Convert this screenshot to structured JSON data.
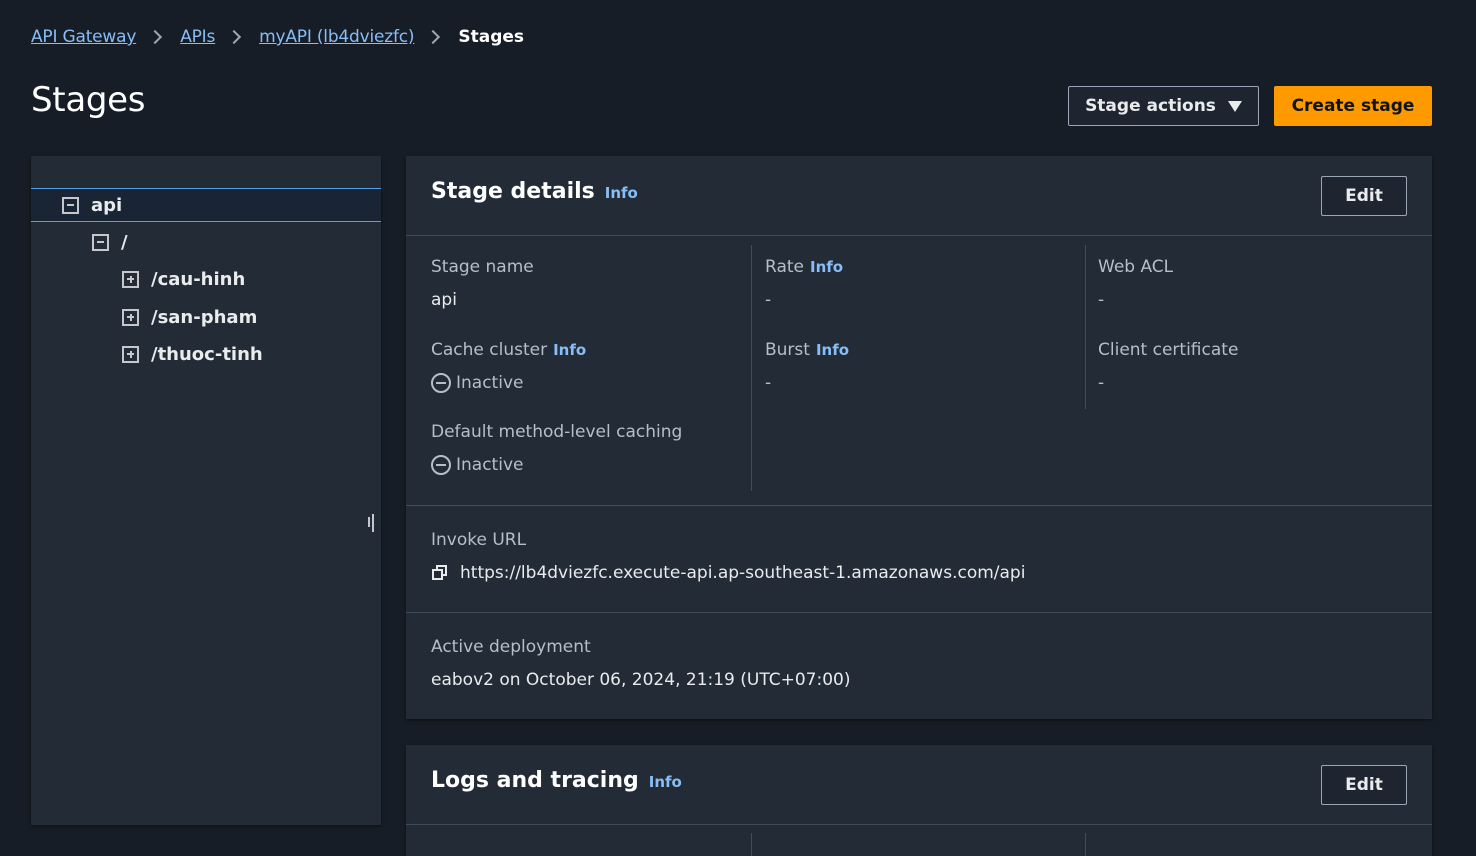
{
  "breadcrumb": {
    "items": [
      "API Gateway",
      "APIs",
      "myAPI (lb4dviezfc)"
    ],
    "current": "Stages"
  },
  "page": {
    "title": "Stages",
    "stage_actions_label": "Stage actions",
    "create_stage_label": "Create stage"
  },
  "tree": {
    "root": "api",
    "child": "/",
    "resources": [
      "/cau-hinh",
      "/san-pham",
      "/thuoc-tinh"
    ]
  },
  "stage_details": {
    "title": "Stage details",
    "info": "Info",
    "edit_label": "Edit",
    "stage_name_label": "Stage name",
    "stage_name_value": "api",
    "rate_label": "Rate",
    "rate_value": "-",
    "web_acl_label": "Web ACL",
    "web_acl_value": "-",
    "cache_cluster_label": "Cache cluster",
    "cache_cluster_value": "Inactive",
    "burst_label": "Burst",
    "burst_value": "-",
    "client_cert_label": "Client certificate",
    "client_cert_value": "-",
    "default_caching_label": "Default method-level caching",
    "default_caching_value": "Inactive",
    "invoke_url_label": "Invoke URL",
    "invoke_url_value": "https://lb4dviezfc.execute-api.ap-southeast-1.amazonaws.com/api",
    "active_deployment_label": "Active deployment",
    "active_deployment_value": "eabov2 on October 06, 2024, 21:19 (UTC+07:00)"
  },
  "logs_tracing": {
    "title": "Logs and tracing",
    "info": "Info",
    "edit_label": "Edit"
  },
  "colors": {
    "background": "#161d26",
    "panel": "#232b37",
    "link": "#89bdf6",
    "primary": "#ff9900",
    "selected_border": "#539fe5"
  }
}
